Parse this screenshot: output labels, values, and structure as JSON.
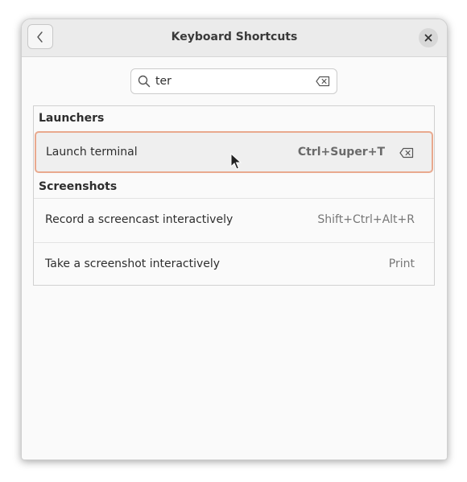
{
  "window": {
    "title": "Keyboard Shortcuts"
  },
  "icons": {
    "back": "chevron-left-icon",
    "close": "close-icon",
    "search": "search-icon",
    "clear": "backspace-icon"
  },
  "search": {
    "value": "ter"
  },
  "sections": [
    {
      "header": "Launchers",
      "rows": [
        {
          "label": "Launch terminal",
          "accel": "Ctrl+Super+T"
        }
      ]
    },
    {
      "header": "Screenshots",
      "rows": [
        {
          "label": "Record a screencast interactively",
          "accel": "Shift+Ctrl+Alt+R"
        },
        {
          "label": "Take a screenshot interactively",
          "accel": "Print"
        }
      ]
    }
  ],
  "colors": {
    "selection_border": "#e9a98e",
    "header_bar": "#ebebeb"
  }
}
